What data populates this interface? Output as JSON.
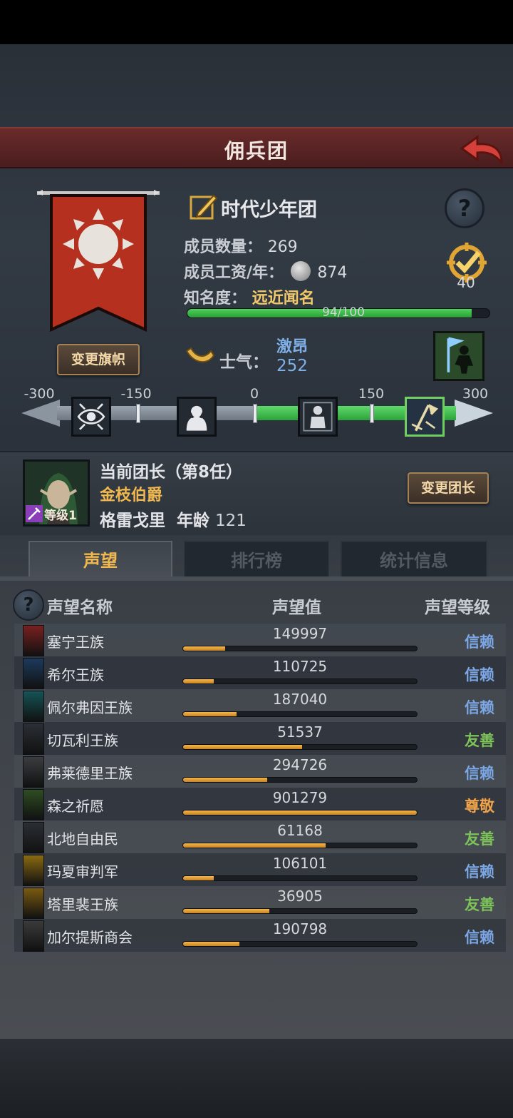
{
  "header": {
    "title": "佣兵团"
  },
  "guild": {
    "name": "时代少年团",
    "members_label": "成员数量：",
    "members_value": "269",
    "salary_label": "成员工资/年：",
    "salary_value": "874",
    "fame_label": "知名度：",
    "fame_value": "远近闻名",
    "fame_progress_text": "94/100",
    "fame_progress": 0.94,
    "target_value": "40",
    "change_banner_label": "变更旗帜",
    "morale_label": "士气：",
    "morale_status": "激昂",
    "morale_value": "252"
  },
  "morale_scale": {
    "ticks": [
      "-300",
      "-150",
      "0",
      "150",
      "300"
    ]
  },
  "leader": {
    "title": "当前团长（第8任）",
    "rank": "金枝伯爵",
    "name": "格雷戈里",
    "age_label": "年龄",
    "age_value": "121",
    "level": "等级1",
    "change_leader_label": "变更团长"
  },
  "tabs": [
    "声望",
    "排行榜",
    "统计信息"
  ],
  "reputation": {
    "headers": {
      "name": "声望名称",
      "value": "声望值",
      "level": "声望等级"
    },
    "rows": [
      {
        "name": "塞宁王族",
        "value": "149997",
        "fill": 0.18,
        "level": "信赖",
        "tier": "trust",
        "icon_color": "#7a2020"
      },
      {
        "name": "希尔王族",
        "value": "110725",
        "fill": 0.13,
        "level": "信赖",
        "tier": "trust",
        "icon_color": "#1c3a5c"
      },
      {
        "name": "佩尔弗因王族",
        "value": "187040",
        "fill": 0.23,
        "level": "信赖",
        "tier": "trust",
        "icon_color": "#145456"
      },
      {
        "name": "切瓦利王族",
        "value": "51537",
        "fill": 0.51,
        "level": "友善",
        "tier": "friend",
        "icon_color": "#2a2f35"
      },
      {
        "name": "弗莱德里王族",
        "value": "294726",
        "fill": 0.36,
        "level": "信赖",
        "tier": "trust",
        "icon_color": "#3a3d40"
      },
      {
        "name": "森之祈愿",
        "value": "901279",
        "fill": 1.0,
        "level": "尊敬",
        "tier": "respect",
        "icon_color": "#2e4d22"
      },
      {
        "name": "北地自由民",
        "value": "61168",
        "fill": 0.61,
        "level": "友善",
        "tier": "friend",
        "icon_color": "#2a2f35"
      },
      {
        "name": "玛夏审判军",
        "value": "106101",
        "fill": 0.13,
        "level": "信赖",
        "tier": "trust",
        "icon_color": "#8a6a10"
      },
      {
        "name": "塔里裴王族",
        "value": "36905",
        "fill": 0.37,
        "level": "友善",
        "tier": "friend",
        "icon_color": "#7a5a10"
      },
      {
        "name": "加尔提斯商会",
        "value": "190798",
        "fill": 0.24,
        "level": "信赖",
        "tier": "trust",
        "icon_color": "#3a3a3a"
      }
    ]
  }
}
